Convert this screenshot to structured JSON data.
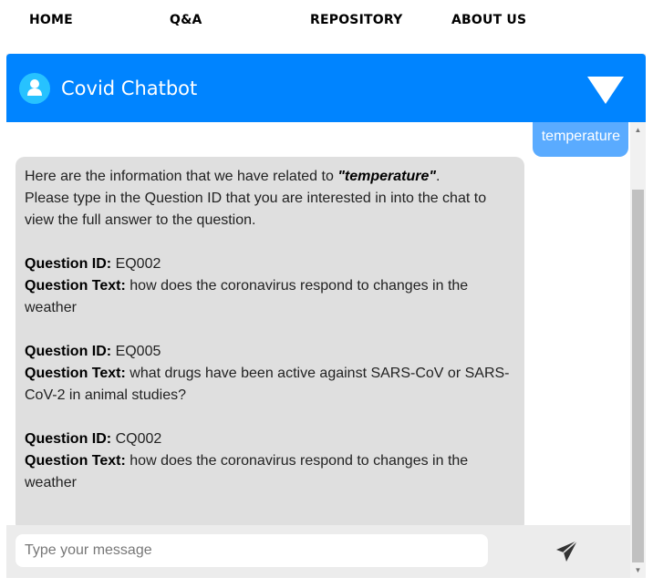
{
  "nav": {
    "home": "HOME",
    "qa": "Q&A",
    "repository": "REPOSITORY",
    "about": "ABOUT US"
  },
  "chat": {
    "title": "Covid Chatbot",
    "user_message": "temperature",
    "bot": {
      "intro_prefix": "Here are the information that we have related to ",
      "query": "\"temperature\"",
      "intro_suffix": ".",
      "instruction": "Please type in the Question ID that you are interested in into the chat to view the full answer to the question.",
      "id_label": "Question ID:",
      "text_label": "Question Text:",
      "results": [
        {
          "id": "EQ002",
          "text": "how does the coronavirus respond to changes in the weather"
        },
        {
          "id": "EQ005",
          "text": "what drugs have been active against SARS-CoV or SARS-CoV-2 in animal studies?"
        },
        {
          "id": "CQ002",
          "text": "how does the coronavirus respond to changes in the weather"
        }
      ]
    },
    "input_placeholder": "Type your message"
  },
  "icons": {
    "avatar": "user-icon",
    "toggle": "triangle-down-icon",
    "send": "paper-plane-icon"
  },
  "colors": {
    "header": "#0084ff",
    "user_bubble": "#5aabff",
    "bot_bubble": "#dfdfdf",
    "avatar": "#27c2ff"
  }
}
